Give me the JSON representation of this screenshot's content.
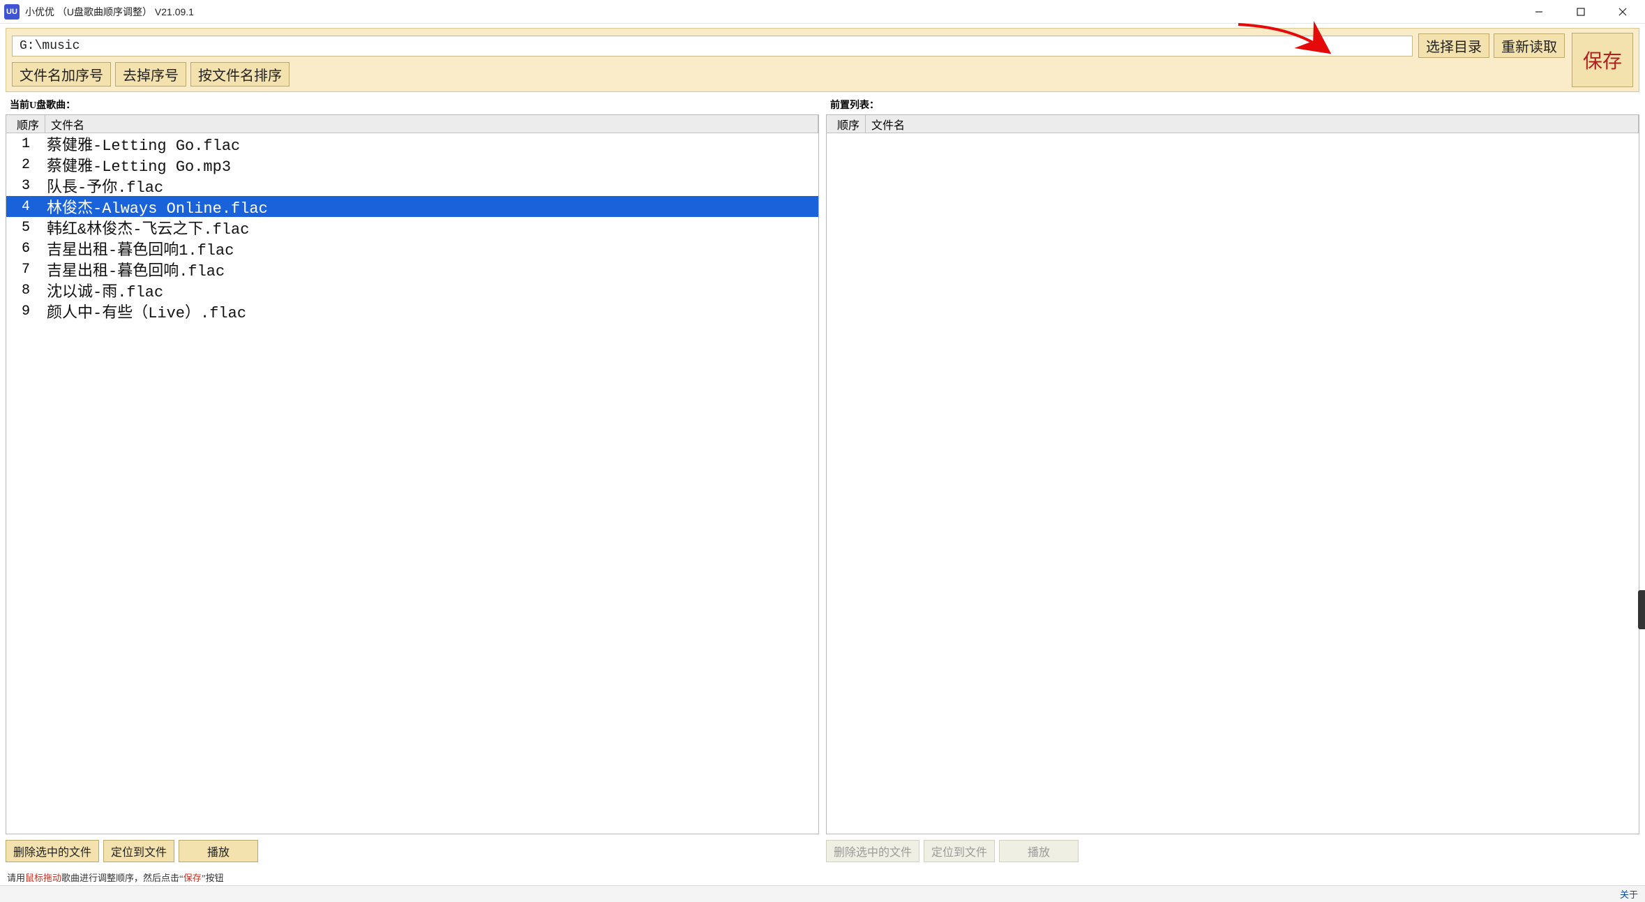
{
  "window": {
    "app_icon_text": "UU",
    "title": "小优优 （U盘歌曲顺序调整） V21.09.1"
  },
  "toolbar": {
    "path_value": "G:\\music",
    "select_dir": "选择目录",
    "reload": "重新读取",
    "save": "保存",
    "add_prefix": "文件名加序号",
    "remove_prefix": "去掉序号",
    "sort_by_name": "按文件名排序"
  },
  "sections": {
    "left_label": "当前U盘歌曲：",
    "right_label": "前置列表："
  },
  "columns": {
    "order": "顺序",
    "filename": "文件名"
  },
  "left_list": {
    "selected_index": 3,
    "rows": [
      {
        "order": "1",
        "name": "蔡健雅-Letting Go.flac"
      },
      {
        "order": "2",
        "name": "蔡健雅-Letting Go.mp3"
      },
      {
        "order": "3",
        "name": "队長-予你.flac"
      },
      {
        "order": "4",
        "name": "林俊杰-Always Online.flac"
      },
      {
        "order": "5",
        "name": "韩红&林俊杰-飞云之下.flac"
      },
      {
        "order": "6",
        "name": "吉星出租-暮色回响1.flac"
      },
      {
        "order": "7",
        "name": "吉星出租-暮色回响.flac"
      },
      {
        "order": "8",
        "name": "沈以诚-雨.flac"
      },
      {
        "order": "9",
        "name": "颜人中-有些（Live）.flac"
      }
    ]
  },
  "right_list": {
    "rows": []
  },
  "bottom": {
    "delete_selected": "删除选中的文件",
    "locate_file": "定位到文件",
    "play": "播放"
  },
  "help": {
    "pre": "请用",
    "red1": "鼠标拖动",
    "mid": "歌曲进行调整顺序，然后点击“",
    "red2": "保存",
    "post": "”按钮"
  },
  "status": {
    "about": "关于"
  }
}
